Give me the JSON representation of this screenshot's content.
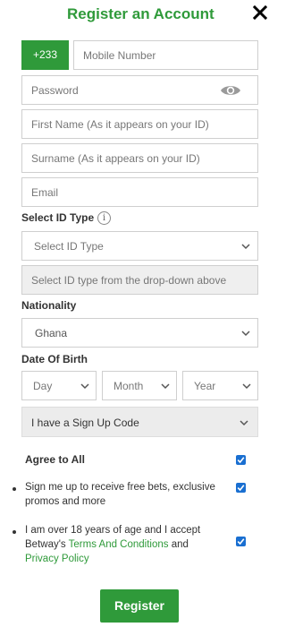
{
  "header": {
    "title": "Register an Account"
  },
  "mobile": {
    "prefix": "+233",
    "placeholder": "Mobile Number"
  },
  "password": {
    "placeholder": "Password"
  },
  "first_name": {
    "placeholder": "First Name (As it appears on your ID)"
  },
  "surname": {
    "placeholder": "Surname (As it appears on your ID)"
  },
  "email": {
    "placeholder": "Email"
  },
  "id_type": {
    "label": "Select ID Type",
    "select_placeholder": "Select ID Type",
    "number_placeholder": "Select ID type from the drop-down above"
  },
  "nationality": {
    "label": "Nationality",
    "value": "Ghana"
  },
  "dob": {
    "label": "Date Of Birth",
    "day": "Day",
    "month": "Month",
    "year": "Year"
  },
  "signup_code": {
    "label": "I have a Sign Up Code"
  },
  "consent": {
    "agree_all": "Agree to All",
    "free_bets": "Sign me up to receive free bets, exclusive promos and more",
    "age_prefix": "I am over 18 years of age and I accept Betway's ",
    "terms_link": "Terms And Conditions",
    "and_text": " and",
    "privacy_link": "Privacy Policy"
  },
  "register_button": "Register",
  "colors": {
    "brand_green": "#2f9a3a",
    "checkbox_blue": "#1a6fd1"
  }
}
